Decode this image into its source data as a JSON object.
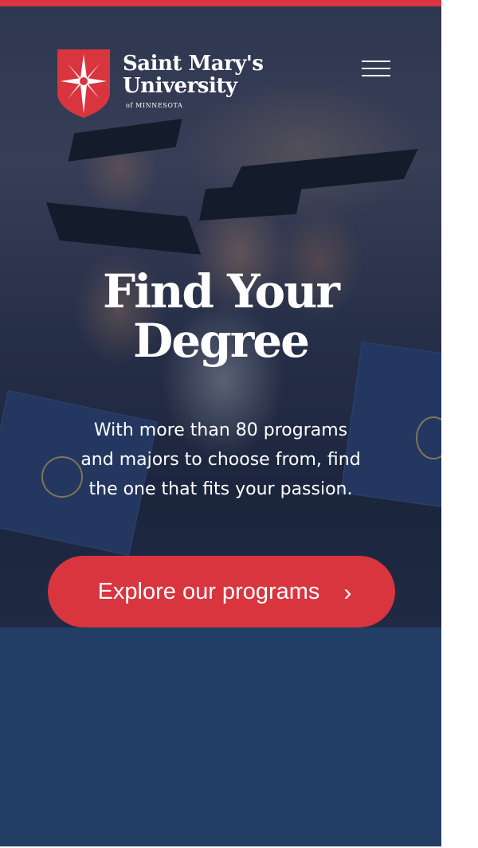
{
  "header": {
    "logo_name_line1": "Saint Mary's",
    "logo_name_line2": "University",
    "logo_subline": "of MINNESOTA",
    "menu_icon": "hamburger-menu-icon"
  },
  "hero": {
    "headline_line1": "Find Your",
    "headline_line2": "Degree",
    "intro": "With more than 80 programs and majors to choose from, find the one that fits your passion.",
    "cta_label": "Explore our programs",
    "cta_icon": "chevron-right-icon"
  },
  "colors": {
    "brand_red": "#d8353f",
    "brand_navy": "#223e64",
    "text": "#ffffff"
  }
}
